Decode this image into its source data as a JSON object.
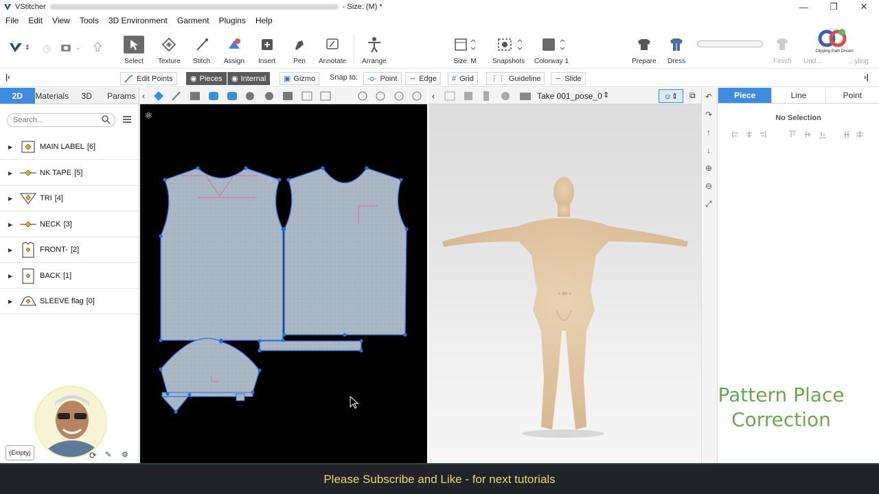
{
  "window": {
    "app_name": "VStitcher",
    "title_suffix": "- Size: (M) *",
    "controls": [
      "minimize",
      "restore",
      "close"
    ]
  },
  "menu": [
    "File",
    "Edit",
    "View",
    "Tools",
    "3D Environment",
    "Garment",
    "Plugins",
    "Help"
  ],
  "toolbar": {
    "select": "Select",
    "texture": "Texture",
    "stitch": "Stitch",
    "assign": "Assign",
    "insert": "Insert",
    "pen": "Pen",
    "annotate": "Annotate",
    "arrange": "Arrange",
    "size": "Size: M",
    "snapshots": "Snapshots",
    "colorway": "Colorway 1",
    "prepare": "Prepare",
    "dress": "Dress",
    "finish": "Finish",
    "undress": "Und...",
    "styling": "...yling",
    "logo_text": "Clipping Path Dream"
  },
  "subbar": {
    "edit_points": "Edit Points",
    "pieces": "Pieces",
    "internal": "Internal",
    "gizmo": "Gizmo",
    "snap_to": "Snap to:",
    "point": "Point",
    "edge": "Edge",
    "grid": "Grid",
    "guideline": "Guideline",
    "slide": "Slide"
  },
  "left_tabs": [
    "2D",
    "Materials",
    "3D",
    "Params"
  ],
  "search_placeholder": "Search...",
  "pieces": [
    {
      "name": "MAIN LABEL",
      "count": "[6]"
    },
    {
      "name": "NK TAPE",
      "count": "[5]"
    },
    {
      "name": "TRI",
      "count": "[4]"
    },
    {
      "name": "NECK",
      "count": "[3]"
    },
    {
      "name": "FRONT-",
      "count": "[2]"
    },
    {
      "name": "BACK",
      "count": "[1]"
    },
    {
      "name": "SLEEVE flag",
      "count": "[0]"
    }
  ],
  "empty_label": "(Empty)",
  "view3d": {
    "take": "Take 001_pose_0"
  },
  "props": {
    "tabs": [
      "Piece",
      "Line",
      "Point"
    ],
    "status": "No Selection"
  },
  "overlay": {
    "line1": "Pattern Place",
    "line2": "Correction"
  },
  "banner": "Please Subscribe and Like - for next tutorials",
  "colors": {
    "accent": "#3c8dde",
    "fabric": "#a9b7c4",
    "point": "#2f6fe0",
    "overlay_text": "#6aa84f",
    "banner_text": "#e8d56a"
  }
}
